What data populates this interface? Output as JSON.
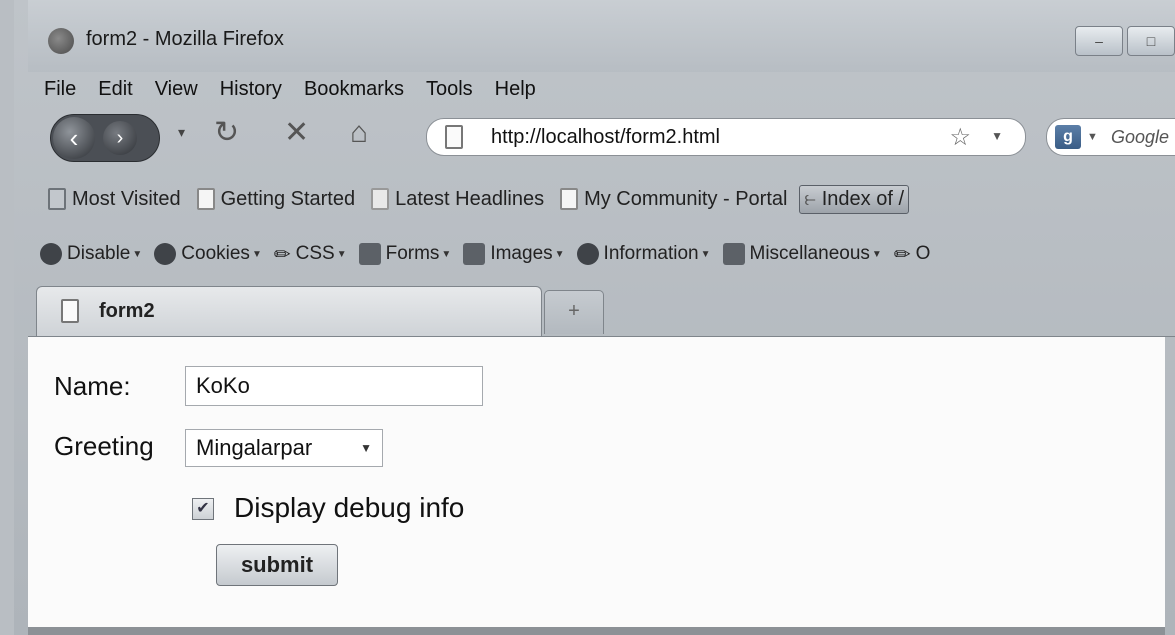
{
  "window": {
    "title": "form2 - Mozilla Firefox"
  },
  "menu": [
    "File",
    "Edit",
    "View",
    "History",
    "Bookmarks",
    "Tools",
    "Help"
  ],
  "navbar": {
    "url": "http://localhost/form2.html",
    "search_placeholder": "Google"
  },
  "bookmarks": [
    "Most Visited",
    "Getting Started",
    "Latest Headlines",
    "My Community - Portal",
    "Index of /"
  ],
  "devtoolbar": [
    "Disable",
    "Cookies",
    "CSS",
    "Forms",
    "Images",
    "Information",
    "Miscellaneous",
    "O"
  ],
  "tab": {
    "title": "form2",
    "new_tab": "+"
  },
  "form": {
    "name_label": "Name:",
    "name_value": "KoKo",
    "greeting_label": "Greeting",
    "greeting_value": "Mingalarpar",
    "debug_label": "Display debug info",
    "debug_checked": true,
    "submit_label": "submit"
  }
}
